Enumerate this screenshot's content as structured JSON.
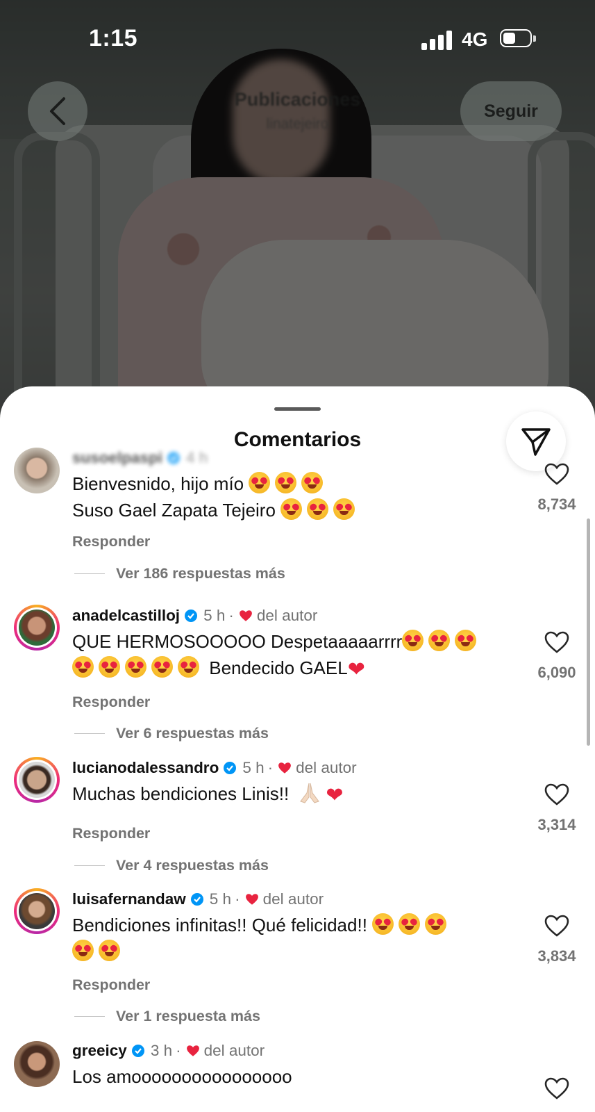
{
  "status_bar": {
    "time": "1:15",
    "network": "4G"
  },
  "nav": {
    "title": "Publicaciones",
    "subtitle": "linatejeiro",
    "follow_label": "Seguir"
  },
  "sheet": {
    "title": "Comentarios"
  },
  "comments": [
    {
      "username": "susoelpaspi",
      "age": "4 h",
      "author_like": "",
      "lines": [
        "Bienvesnido, hijo mío",
        "Suso Gael Zapata Tejeiro"
      ],
      "reply_label": "Responder",
      "more_replies": "Ver 186 respuestas más",
      "likes": "8,734"
    },
    {
      "username": "anadelcastilloj",
      "age": "5 h",
      "author_like": "del autor",
      "lines": [
        "QUE HERMOSOOOOO Despetaaaaarrrr",
        "Bendecido GAEL"
      ],
      "reply_label": "Responder",
      "more_replies": "Ver 6 respuestas más",
      "likes": "6,090"
    },
    {
      "username": "lucianodalessandro",
      "age": "5 h",
      "author_like": "del autor",
      "lines": [
        "Muchas bendiciones Linis!!"
      ],
      "reply_label": "Responder",
      "more_replies": "Ver 4 respuestas más",
      "likes": "3,314"
    },
    {
      "username": "luisafernandaw",
      "age": "5 h",
      "author_like": "del autor",
      "lines": [
        "Bendiciones infinitas!! Qué felicidad!!"
      ],
      "reply_label": "Responder",
      "more_replies": "Ver 1 respuesta más",
      "likes": "3,834"
    },
    {
      "username": "greeicy",
      "age": "3 h",
      "author_like": "del autor",
      "lines": [
        "Los amoooooooooooooooo"
      ],
      "likes": ""
    }
  ],
  "icons": {
    "back": "chevron-left-icon",
    "share": "paper-plane-icon",
    "like": "heart-outline-icon",
    "verified": "verified-badge-icon",
    "author_like": "red-heart-icon"
  },
  "colors": {
    "verified": "#0095f6",
    "heart": "#e8233f",
    "muted": "#737373"
  }
}
